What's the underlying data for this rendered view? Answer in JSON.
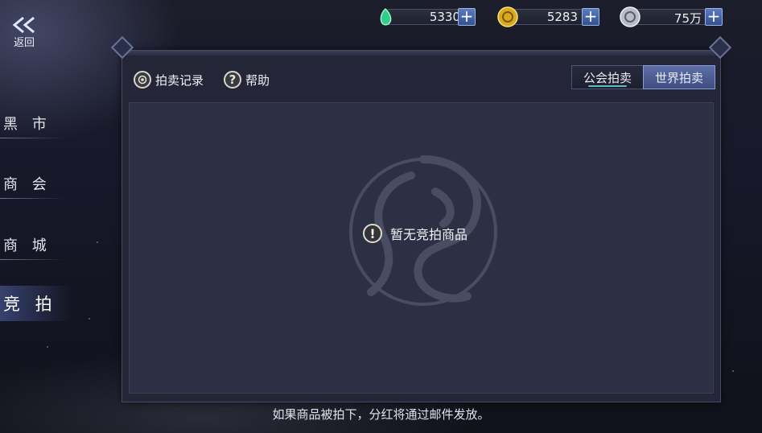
{
  "nav": {
    "back_label": "返回"
  },
  "currency": {
    "jade": {
      "icon": "green-jade-icon",
      "value": "5330",
      "color": "#2ecf8a"
    },
    "gold": {
      "icon": "gold-coin-icon",
      "value": "5283",
      "color": "#e8c23a"
    },
    "silver": {
      "icon": "silver-coin-icon",
      "value": "75万",
      "color": "#cfd2d8"
    },
    "plus_label": "+"
  },
  "sidebar": {
    "items": [
      {
        "label": "黑 市",
        "active": false
      },
      {
        "label": "商 会",
        "active": false
      },
      {
        "label": "商 城",
        "active": false
      },
      {
        "label": "竞 拍",
        "active": true
      }
    ]
  },
  "toolbar": {
    "record_label": "拍卖记录",
    "help_label": "帮助",
    "help_icon_char": "?"
  },
  "tabs": [
    {
      "label": "公会拍卖",
      "active": false
    },
    {
      "label": "世界拍卖",
      "active": true
    }
  ],
  "content": {
    "empty_icon_char": "!",
    "empty_text": "暂无竞拍商品"
  },
  "footer": {
    "note": "如果商品被拍下，分红将通过邮件发放。"
  }
}
